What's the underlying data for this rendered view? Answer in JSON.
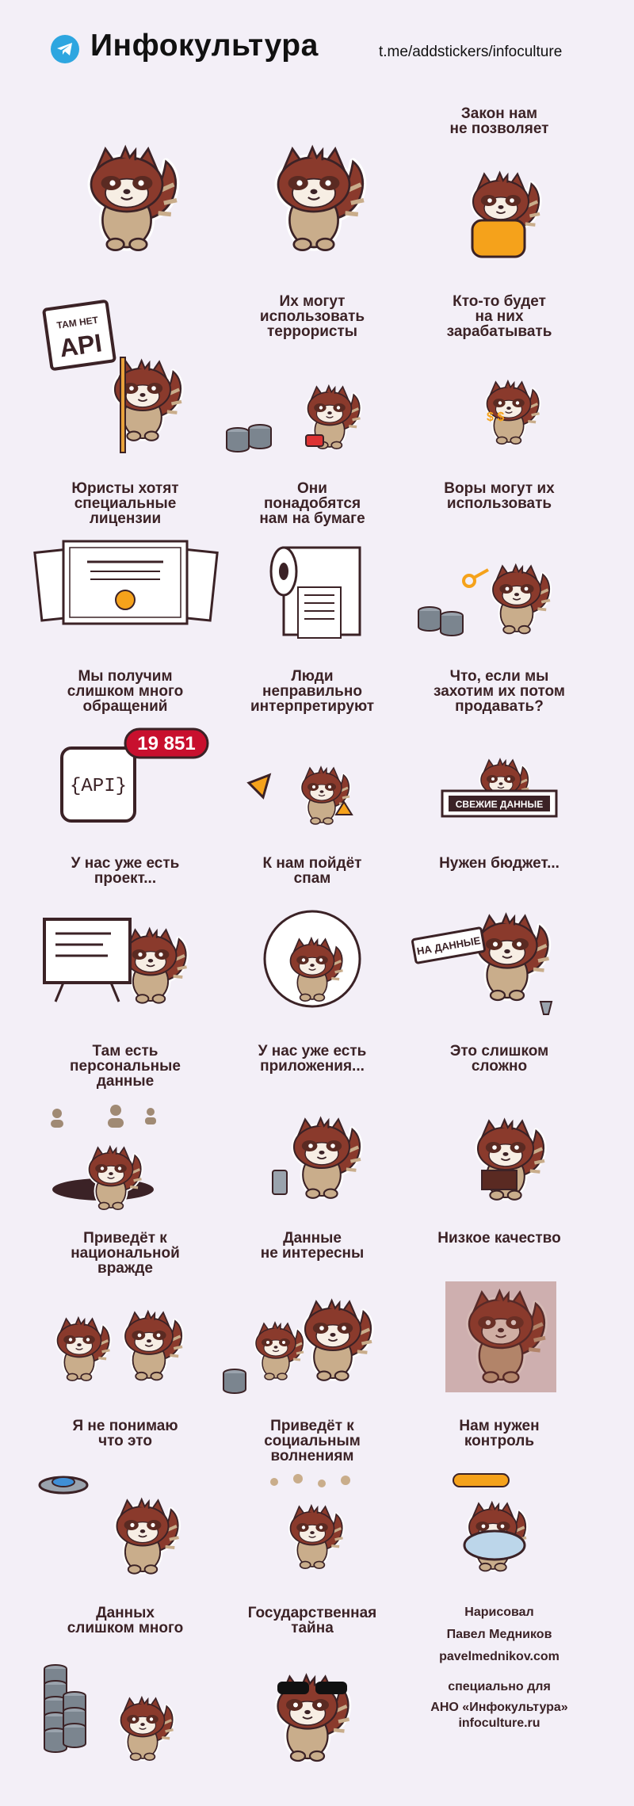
{
  "header": {
    "title": "Инфокультура",
    "link": "t.me/addstickers/infoculture"
  },
  "stickers": [
    {
      "caption": ""
    },
    {
      "caption": ""
    },
    {
      "caption": "Закон нам\nне позволяет"
    },
    {
      "caption": "",
      "sign_line1": "ТАМ НЕТ",
      "sign_line2": "API"
    },
    {
      "caption": "Их могут\nиспользовать\nтеррористы"
    },
    {
      "caption": "Кто-то будет\nна них\nзарабатывать"
    },
    {
      "caption": "Юристы хотят\nспециальные\nлицензии"
    },
    {
      "caption": "Они\nпонадобятся\nнам на бумаге"
    },
    {
      "caption": "Воры могут их\nиспользовать"
    },
    {
      "caption": "Мы получим\nслишком много\nобращений",
      "counter": "19 851",
      "api_label": "{API}"
    },
    {
      "caption": "Люди\nнеправильно\nинтерпретируют"
    },
    {
      "caption": "Что, если мы\nзахотим их потом\nпродавать?",
      "shop_sign": "СВЕЖИЕ ДАННЫЕ"
    },
    {
      "caption": "У нас уже есть\nпроект..."
    },
    {
      "caption": "К нам пойдёт\nспам"
    },
    {
      "caption": "Нужен бюджет...",
      "sign": "НА ДАННЫЕ"
    },
    {
      "caption": "Там есть\nперсональные\nданные"
    },
    {
      "caption": "У нас уже есть\nприложения..."
    },
    {
      "caption": "Это слишком\nсложно"
    },
    {
      "caption": "Приведёт к\nнациональной\nвражде"
    },
    {
      "caption": "Данные\nне интересны"
    },
    {
      "caption": "Низкое качество"
    },
    {
      "caption": "Я не понимаю\nчто это"
    },
    {
      "caption": "Приведёт к\nсоциальным\nволнениям"
    },
    {
      "caption": "Нам нужен\nконтроль"
    },
    {
      "caption": "Данных\nслишком много"
    },
    {
      "caption": "Государственная\nтайна"
    }
  ],
  "credits": {
    "drawn_by": "Нарисовал",
    "author": "Павел Медников",
    "author_site": "pavelmednikov.com",
    "made_for": "специально для",
    "org": "АНО «Инфокультура»",
    "org_site": "infoculture.ru"
  },
  "colors": {
    "background": "#f3eff7",
    "outline": "#3b2226",
    "fur_dark": "#8a3a2c",
    "fur_light": "#c9ad8b",
    "telegram": "#2ea6e0",
    "counter_red": "#c8102e"
  }
}
